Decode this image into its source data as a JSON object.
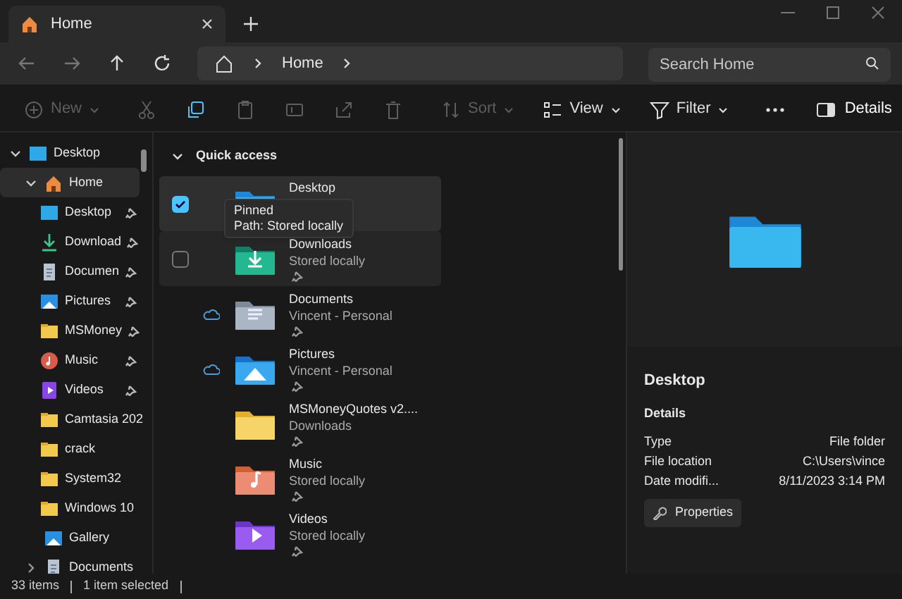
{
  "tab": {
    "title": "Home"
  },
  "address": {
    "crumbs": [
      "Home"
    ],
    "search_placeholder": "Search Home"
  },
  "toolbar": [
    {
      "kind": "new",
      "label": "New",
      "disabled": true
    },
    {
      "kind": "cut",
      "disabled": true
    },
    {
      "kind": "copy",
      "disabled": false
    },
    {
      "kind": "paste",
      "disabled": true
    },
    {
      "kind": "rename",
      "disabled": true
    },
    {
      "kind": "share",
      "disabled": true
    },
    {
      "kind": "delete",
      "disabled": true
    },
    {
      "kind": "sort",
      "label": "Sort",
      "disabled": true
    },
    {
      "kind": "view",
      "label": "View",
      "disabled": false
    },
    {
      "kind": "filter",
      "label": "Filter",
      "disabled": false
    },
    {
      "kind": "more",
      "disabled": false
    }
  ],
  "details_button": {
    "label": "Details",
    "selected": true
  },
  "sidebar": [
    {
      "label": "Desktop",
      "kind": "desktop",
      "expanded": true,
      "selected": false,
      "children": [
        {
          "label": "Home",
          "kind": "home",
          "expanded": true,
          "selected": true,
          "children": [
            {
              "label": "Desktop",
              "kind": "desktop",
              "pinned": true
            },
            {
              "label": "Download",
              "kind": "download",
              "pinned": true
            },
            {
              "label": "Documen",
              "kind": "document",
              "pinned": true
            },
            {
              "label": "Pictures",
              "kind": "pictures",
              "pinned": true
            },
            {
              "label": "MSMoney",
              "kind": "folder",
              "pinned": true
            },
            {
              "label": "Music",
              "kind": "music",
              "pinned": true
            },
            {
              "label": "Videos",
              "kind": "videos",
              "pinned": true
            },
            {
              "label": "Camtasia 202",
              "kind": "folder"
            },
            {
              "label": "crack",
              "kind": "folder"
            },
            {
              "label": "System32",
              "kind": "folder"
            },
            {
              "label": "Windows 10",
              "kind": "folder"
            }
          ]
        },
        {
          "label": "Gallery",
          "kind": "pictures",
          "selected": false
        },
        {
          "label": "Documents",
          "kind": "document",
          "expanded": false,
          "selected": false
        }
      ]
    }
  ],
  "section": {
    "title": "Quick access",
    "expanded": true
  },
  "items": [
    {
      "name": "Desktop",
      "kind": "desktop",
      "selected": true
    },
    {
      "name": "Downloads",
      "subtitle": "Stored locally",
      "kind": "download",
      "selected": false,
      "hover": true,
      "pinned": true
    },
    {
      "name": "Documents",
      "subtitle": "Vincent - Personal",
      "kind": "document",
      "selected": false,
      "cloud": true,
      "pinned": true
    },
    {
      "name": "Pictures",
      "subtitle": "Vincent - Personal",
      "kind": "pictures",
      "selected": false,
      "cloud": true,
      "pinned": true
    },
    {
      "name": "MSMoneyQuotes v2....",
      "subtitle": "Downloads",
      "kind": "folder",
      "selected": false,
      "pinned": true
    },
    {
      "name": "Music",
      "subtitle": "Stored locally",
      "kind": "music",
      "selected": false,
      "pinned": true
    },
    {
      "name": "Videos",
      "subtitle": "Stored locally",
      "kind": "videos",
      "selected": false,
      "pinned": true
    }
  ],
  "tooltip": {
    "lines": [
      "Pinned",
      "Path: Stored locally"
    ]
  },
  "details": {
    "name": "Desktop",
    "heading": "Details",
    "rows": [
      {
        "label": "Type",
        "value": "File folder"
      },
      {
        "label": "File location",
        "value": "C:\\Users\\vince"
      },
      {
        "label": "Date modifi...",
        "value": "8/11/2023 3:14 PM"
      }
    ],
    "button": "Properties"
  },
  "status_bar": [
    "33 items",
    "1 item selected"
  ]
}
